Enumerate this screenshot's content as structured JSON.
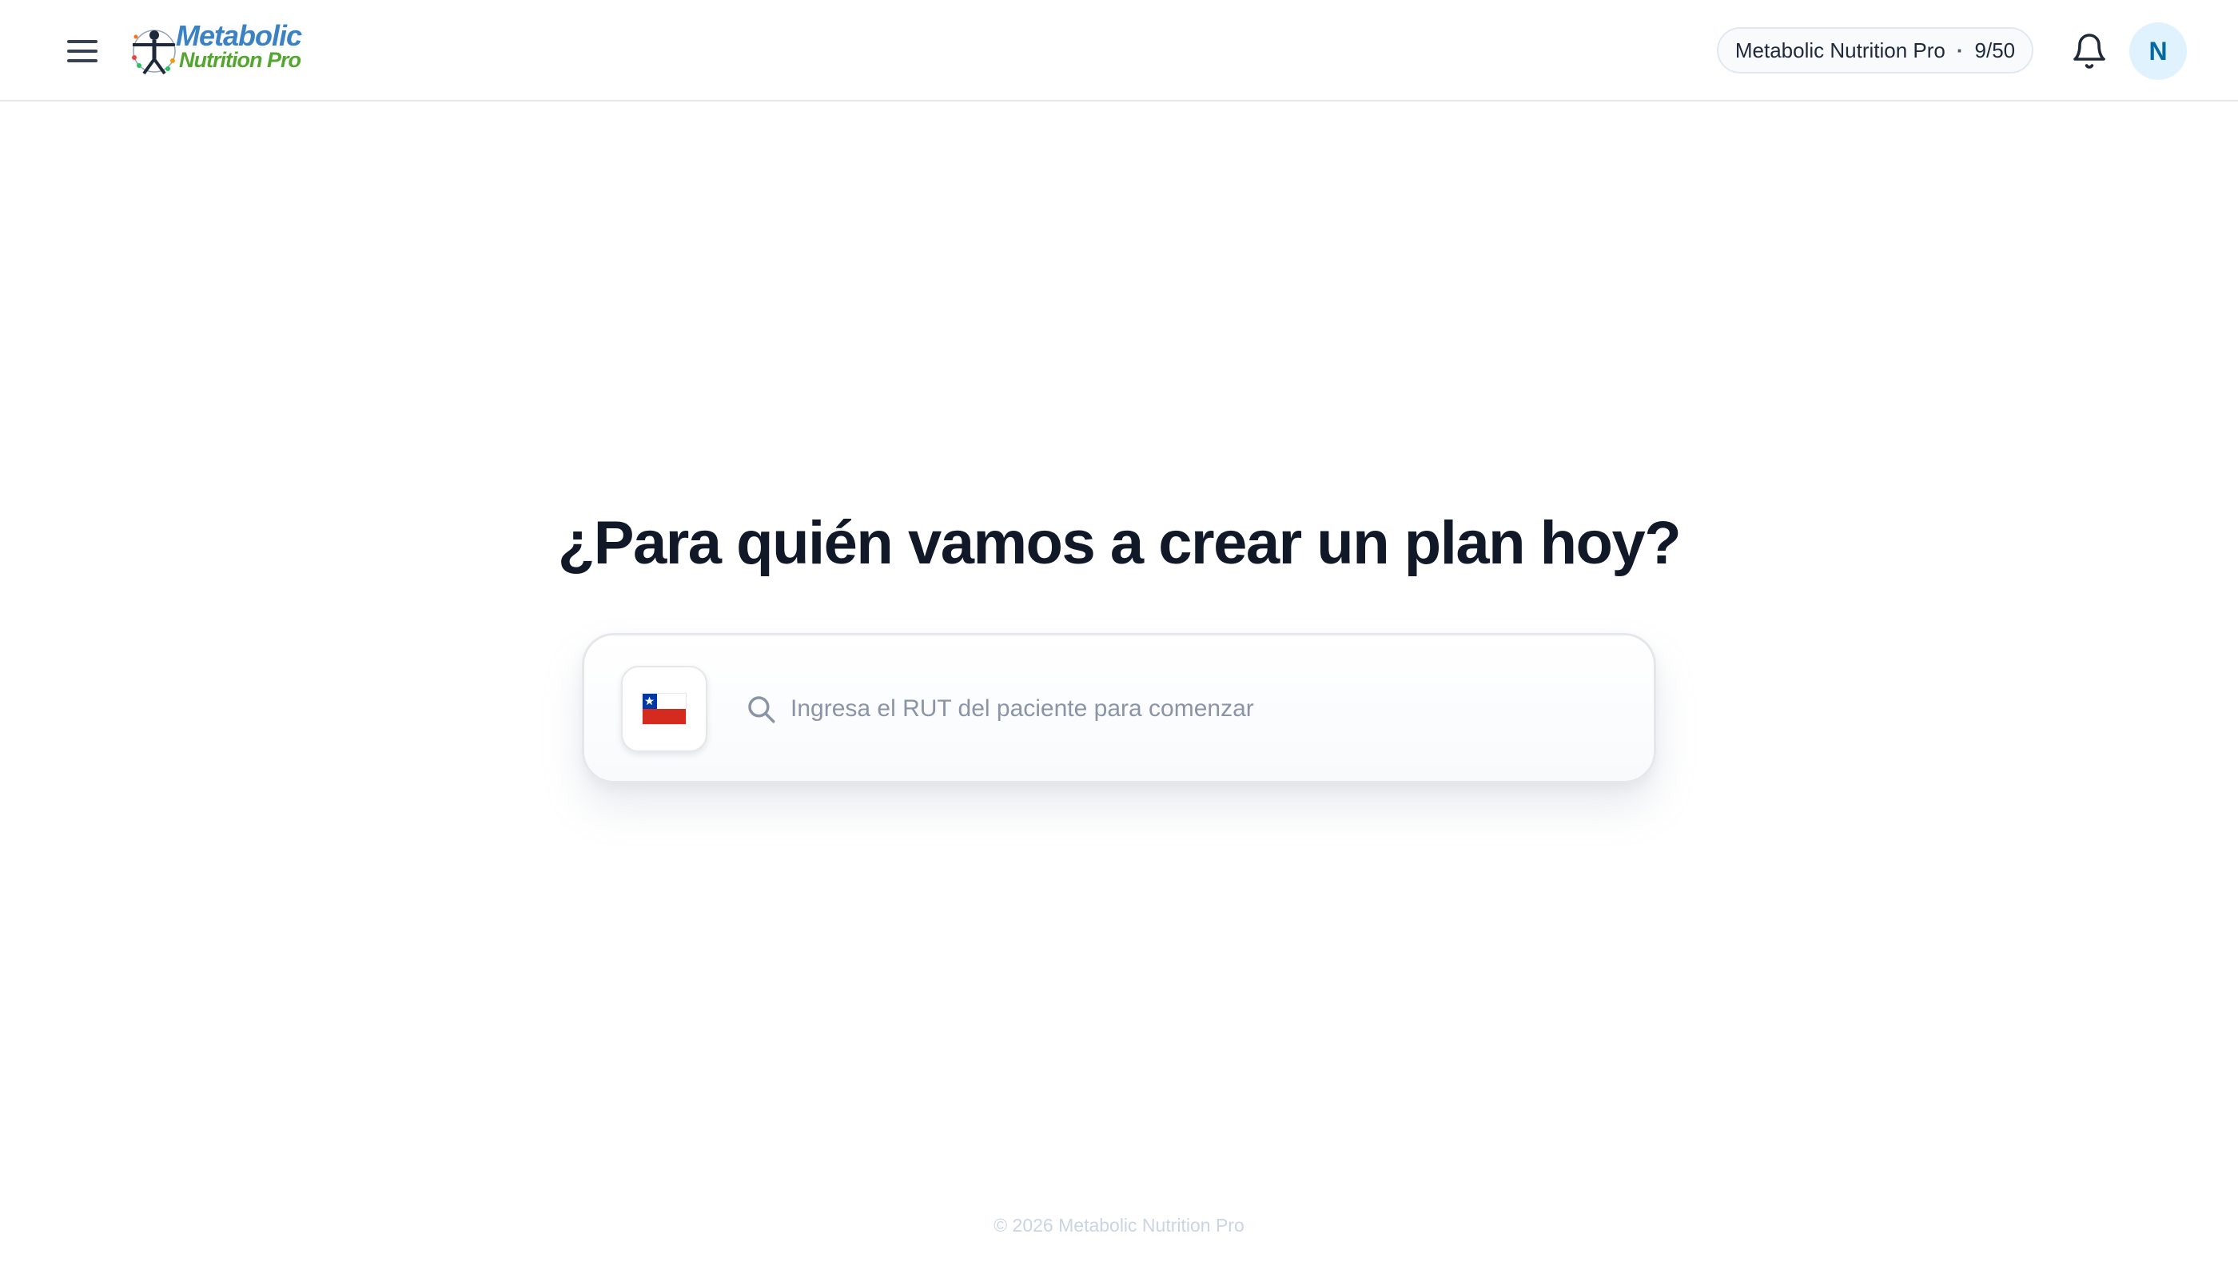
{
  "header": {
    "menu_icon": "hamburger-menu-icon",
    "logo": {
      "line1": "Metabolic",
      "line2": "Nutrition Pro"
    },
    "plan_badge": {
      "name": "Metabolic Nutrition Pro",
      "separator": "·",
      "usage": "9/50"
    },
    "notifications_icon": "bell-icon",
    "avatar_initial": "N"
  },
  "main": {
    "headline": "¿Para quién vamos a crear un plan hoy?",
    "search": {
      "country_flag": "chile-flag-icon",
      "search_icon": "search-icon",
      "placeholder": "Ingresa el RUT del paciente para comenzar",
      "value": ""
    }
  },
  "footer": {
    "copyright": "© 2026 Metabolic Nutrition Pro"
  },
  "colors": {
    "accent": "#0369a1",
    "avatar_bg": "#e0f2fe",
    "flag_red": "#d52b1e",
    "flag_blue": "#0039a6",
    "headline": "#111827"
  }
}
